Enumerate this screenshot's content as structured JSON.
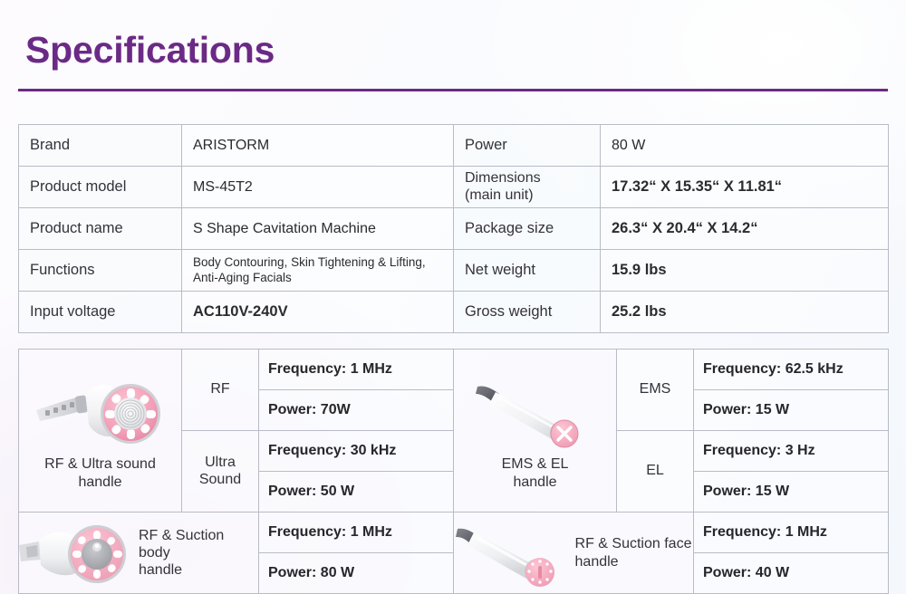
{
  "header": {
    "title": "Specifications",
    "accent_color": "#6b2a85"
  },
  "spec_table": {
    "rows": [
      {
        "left_key": "Brand",
        "left_value": "ARISTORM",
        "left_bold": false,
        "right_key": "Power",
        "right_value": "80 W",
        "right_bold": false
      },
      {
        "left_key": "Product model",
        "left_value": "MS-45T2",
        "left_bold": false,
        "right_key_line1": "Dimensions",
        "right_key_line2": "(main unit)",
        "right_value": "17.32“ X 15.35“ X 11.81“",
        "right_bold": true
      },
      {
        "left_key": "Product name",
        "left_value": "S Shape Cavitation Machine",
        "left_bold": false,
        "right_key": "Package size",
        "right_value": "26.3“ X 20.4“ X 14.2“",
        "right_bold": true
      },
      {
        "left_key": "Functions",
        "left_value_line1": "Body Contouring, Skin Tightening & Lifting,",
        "left_value_line2": "Anti-Aging Facials",
        "right_key": "Net weight",
        "right_value": "15.9 lbs",
        "right_bold": true
      },
      {
        "left_key": "Input voltage",
        "left_value": "AC110V-240V",
        "left_bold": true,
        "right_key": "Gross weight",
        "right_value": "25.2 lbs",
        "right_bold": true
      }
    ]
  },
  "handles_table": {
    "rf_ultrasound": {
      "caption_line1": "RF & Ultra sound",
      "caption_line2": "handle",
      "image_name": "rf-ultrasound-handle-image",
      "modes": [
        {
          "name": "RF",
          "name_line1": "RF",
          "name_line2": "",
          "frequency": "Frequency: 1 MHz",
          "power": "Power: 70W"
        },
        {
          "name": "Ultra Sound",
          "name_line1": "Ultra",
          "name_line2": "Sound",
          "frequency": "Frequency: 30 kHz",
          "power": "Power: 50 W"
        }
      ]
    },
    "ems_el": {
      "caption_line1": "EMS & EL",
      "caption_line2": "handle",
      "image_name": "ems-el-handle-image",
      "modes": [
        {
          "name": "EMS",
          "name_line1": "EMS",
          "name_line2": "",
          "frequency": "Frequency: 62.5 kHz",
          "power": "Power: 15 W"
        },
        {
          "name": "EL",
          "name_line1": "EL",
          "name_line2": "",
          "frequency": "Frequency: 3 Hz",
          "power": "Power: 15 W"
        }
      ]
    },
    "rf_suction_body": {
      "caption_line1": "RF & Suction body",
      "caption_line2": "handle",
      "image_name": "rf-suction-body-handle-image",
      "frequency": "Frequency: 1 MHz",
      "power": "Power: 80 W"
    },
    "rf_suction_face": {
      "caption_line1": "RF & Suction face",
      "caption_line2": "handle",
      "image_name": "rf-suction-face-handle-image",
      "frequency": "Frequency: 1 MHz",
      "power": "Power: 40 W"
    }
  },
  "colors": {
    "title_purple": "#6b2a85",
    "border_grey": "#b9bcc6",
    "handle_pink": "#f4a9bd",
    "text_dark": "#2b2b30"
  }
}
